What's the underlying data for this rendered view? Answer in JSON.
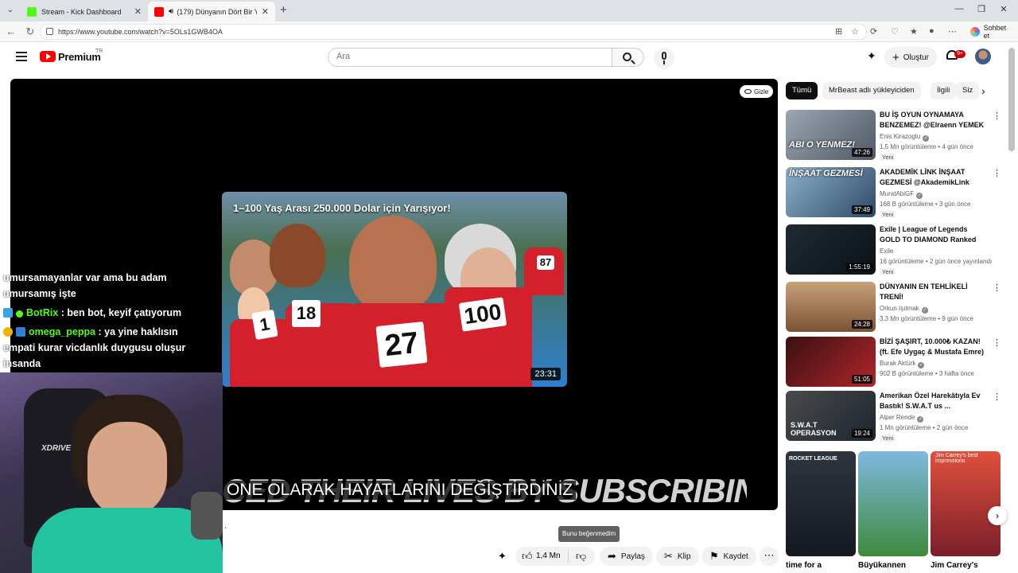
{
  "browser": {
    "tabs": [
      {
        "title": "Stream - Kick Dashboard",
        "favicon_color": "#53fc18"
      },
      {
        "title": "(179) Dünyanın Dört Bir Yanın",
        "favicon_color": "#ff0000"
      }
    ],
    "url": "https://www.youtube.com/watch?v=5OLs1GWB4OA",
    "copilot_label": "Sohbet et"
  },
  "youtube": {
    "logo_text": "Premium",
    "region": "TR",
    "search_placeholder": "Ara",
    "create_label": "Oluştur",
    "notifications_badge": "9+"
  },
  "player": {
    "hide_label": "Gizle",
    "endcard_title": "1–100 Yaş Arası 250.000 Dolar için Yarışıyor!",
    "endcard_duration": "23:31",
    "bib_numbers": [
      "1",
      "18",
      "27",
      "100",
      "87"
    ],
    "caption_background": "CED THEIR LIVES BY SUBSCRIBING",
    "caption_text": "ONE OLARAK HAYATLARINI DEĞİŞTİRDİNİZ"
  },
  "chat": {
    "lines": [
      {
        "user": "",
        "text": "umursamayanlar var ama bu adam"
      },
      {
        "user": "",
        "text": "umursamış işte"
      },
      {
        "user": "BotRix",
        "text": " : ben bot, keyif çatıyorum"
      },
      {
        "user": "omega_peppa",
        "text": " : ya yine haklısın"
      },
      {
        "user": "",
        "text": "empati kurar vicdanlık duygusu oluşur"
      },
      {
        "user": "",
        "text": "insanda"
      }
    ]
  },
  "webcam": {
    "chair_brand": "XDRIVE"
  },
  "actions": {
    "dot": ".",
    "tooltip": "Bunu beğenmedim",
    "like_count": "1,4 Mn",
    "share": "Paylaş",
    "clip": "Klip",
    "save": "Kaydet"
  },
  "chips": [
    "Tümü",
    "MrBeast adlı yükleyiciden",
    "İlgili",
    "Siz"
  ],
  "recommendations": [
    {
      "title": "BU İŞ OYUN OYNAMAYA BENZEMEZ! @Elraenn YEMEK ...",
      "channel": "Enis Kirazoglu",
      "verified": true,
      "meta": "1,5 Mn görüntüleme • 4 gün önce",
      "badge": "Yeni",
      "duration": "47:26",
      "thumb_text": "ABI O YENMEZ!"
    },
    {
      "title": "AKADEMİK LİNK İNŞAAT GEZMESİ @AkademikLink",
      "channel": "MuratAbiGF",
      "verified": true,
      "meta": "168 B görüntüleme • 3 gün önce",
      "badge": "Yeni",
      "duration": "37:49",
      "thumb_text": "İNŞAAT GEZMESİ"
    },
    {
      "title": "Exile | League of Legends GOLD TO DIAMOND Ranked Rush! ...",
      "channel": "Exile",
      "verified": false,
      "meta": "16 görüntüleme • 2 gün önce yayınlandı",
      "badge": "Yeni",
      "duration": "1:55:19",
      "thumb_text": ""
    },
    {
      "title": "DÜNYANIN EN TEHLİKELİ TRENİ!",
      "channel": "Orkun Işıtmak",
      "verified": true,
      "meta": "3,3 Mn görüntüleme • 9 gün önce",
      "badge": "",
      "duration": "24:28",
      "thumb_text": ""
    },
    {
      "title": "BİZİ ŞAŞIRT, 10.000₺ KAZAN! (ft. Efe Uygaç & Mustafa Emre)",
      "channel": "Burak Aktürk",
      "verified": true,
      "meta": "902 B görüntüleme • 3 hafta önce",
      "badge": "",
      "duration": "51:05",
      "thumb_text": ""
    },
    {
      "title": "Amerikan Özel Harekâtıyla Ev Bastık! S.W.A.T us ...",
      "channel": "Alper Rende",
      "verified": true,
      "meta": "1 Mn görüntüleme • 2 gün önce",
      "badge": "Yeni",
      "duration": "19:24",
      "thumb_text": "S.W.A.T OPERASYON"
    }
  ],
  "shorts": [
    {
      "label": "time for a",
      "thumb_text": "ROCKET LEAGUE"
    },
    {
      "label": "Büyükannen",
      "thumb_text": ""
    },
    {
      "label": "Jim Carrey's",
      "thumb_text": "Jim Carrey's best impressions"
    }
  ]
}
